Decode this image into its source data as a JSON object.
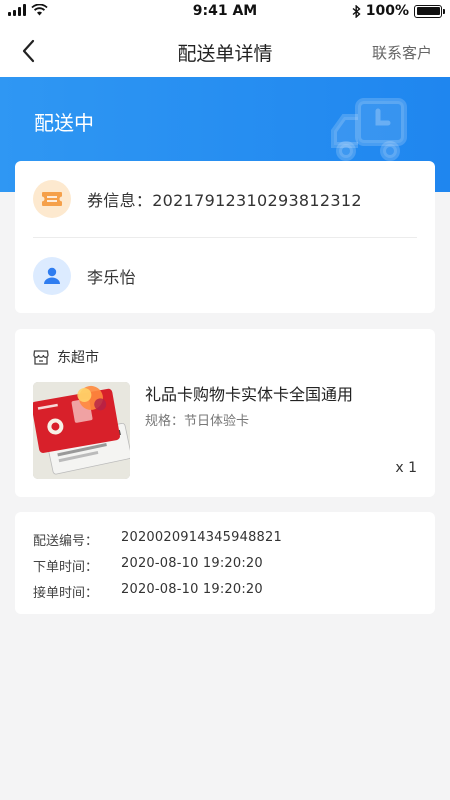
{
  "status_bar": {
    "time": "9:41 AM",
    "battery": "100%",
    "battery_level": 1.0
  },
  "nav": {
    "title": "配送单详情",
    "action": "联系客户"
  },
  "delivery": {
    "status": "配送中"
  },
  "info": {
    "coupon_label": "券信息：",
    "coupon_value": "2021791231029381231­2",
    "customer_name": "李乐怡"
  },
  "goods": {
    "shop_name": "东超市",
    "product_name": "礼品卡购物卡实体卡全国通用",
    "spec_label": "规格：",
    "spec_value": "节日体验卡",
    "quantity": "x 1"
  },
  "order": {
    "rows": [
      {
        "label": "配送编号：",
        "value": "202002091434594882­1"
      },
      {
        "label": "下单时间：",
        "value": "2020-08-10 19:20:20"
      },
      {
        "label": "接单时间：",
        "value": "2020-08-10 19:20:20"
      }
    ]
  },
  "colors": {
    "primary": "#1f86ef",
    "coupon_accent": "#f5a04a",
    "user_accent": "#2f7df0"
  }
}
